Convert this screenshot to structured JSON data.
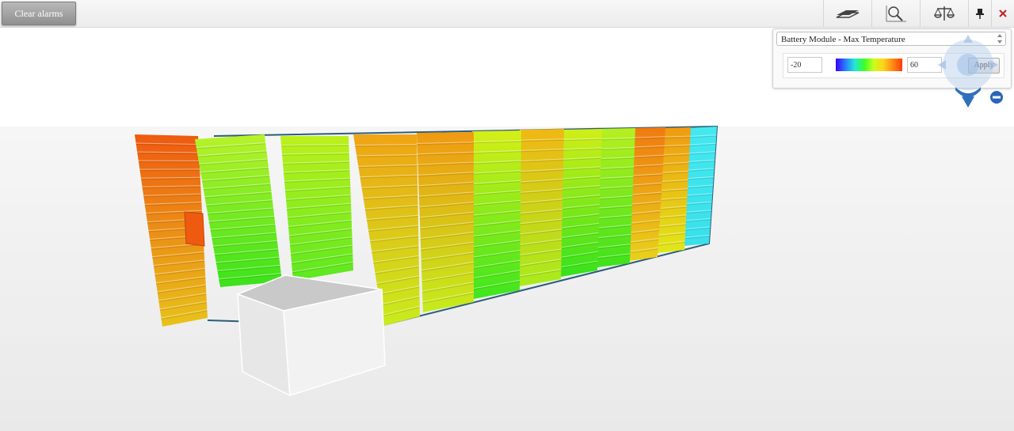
{
  "toolbar": {
    "clear_alarms_label": "Clear alarms",
    "tools": [
      "layers-icon",
      "zoom-region-icon",
      "scales-icon",
      "pin-icon",
      "close-icon"
    ]
  },
  "heatmap_panel": {
    "metric_selected": "Battery Module - Max Temperature",
    "range_min": "-20",
    "range_max": "60",
    "apply_label": "Apply",
    "gradient_colors": [
      "#3a00ff",
      "#2a7bff",
      "#22e8d6",
      "#3aff2a",
      "#c8ff1a",
      "#ffd21a",
      "#ff8a12",
      "#ff3b0a"
    ]
  },
  "scene": {
    "floor_color": "#ececec",
    "rack_colors": {
      "rack-01": [
        "#ee5a10",
        "#e8c21a"
      ],
      "rack-02": [
        "#b9f22a",
        "#3ae21a"
      ],
      "rack-03": [
        "#bdf01c",
        "#5ce820"
      ],
      "rack-04": [
        "#f0a414",
        "#c8ec1c"
      ],
      "rack-05": [
        "#f09a12",
        "#c4ec1c"
      ],
      "rack-06": [
        "#d6ee18",
        "#3ee61e"
      ],
      "rack-07": [
        "#f0b814",
        "#a8ec1c"
      ],
      "rack-08": [
        "#d2ee18",
        "#34e21c"
      ],
      "rack-09": [
        "#b8ef20",
        "#3ee21c"
      ],
      "rack-10": [
        "#f07a10",
        "#e8d21a"
      ],
      "rack-11": [
        "#f09a12",
        "#e0e818"
      ],
      "rack-12": [
        "#44e8f0",
        "#38e0ea"
      ]
    }
  }
}
